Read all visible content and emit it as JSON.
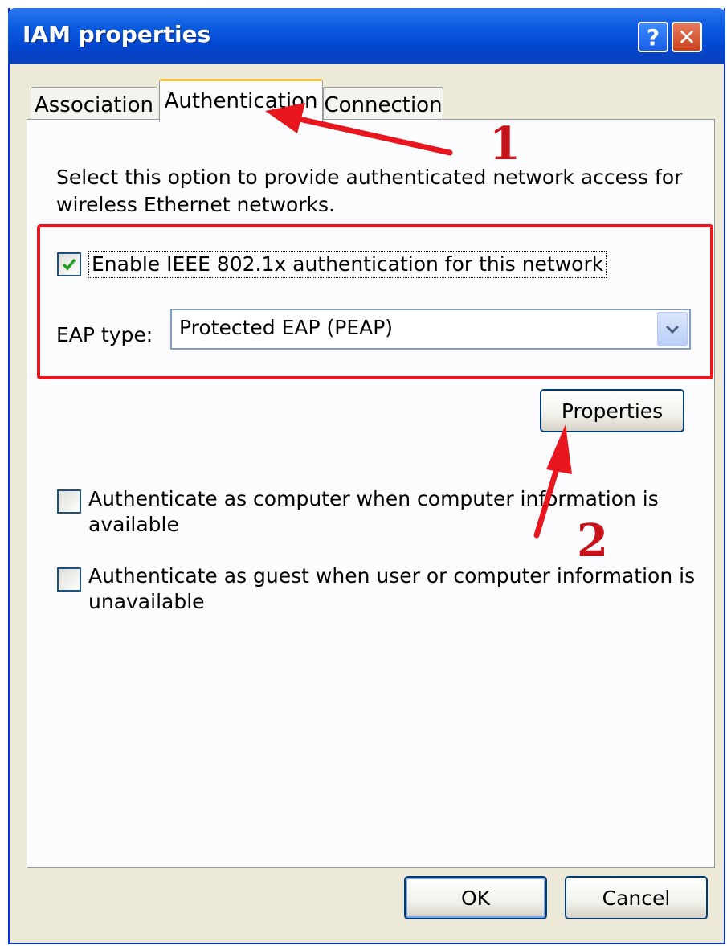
{
  "window": {
    "title": "IAM properties",
    "help_glyph": "?",
    "close_glyph": "✕"
  },
  "tabs": [
    {
      "label": "Association",
      "selected": false
    },
    {
      "label": "Authentication",
      "selected": true
    },
    {
      "label": "Connection",
      "selected": false
    }
  ],
  "authentication": {
    "description": "Select this option to provide authenticated network access for wireless Ethernet networks.",
    "enable_8021x": {
      "label": "Enable IEEE 802.1x authentication for this network",
      "checked": true
    },
    "eap_type": {
      "label": "EAP type:",
      "value": "Protected EAP (PEAP)"
    },
    "properties_button": "Properties",
    "auth_as_computer": {
      "label": "Authenticate as computer when computer information is available",
      "checked": false
    },
    "auth_as_guest": {
      "label": "Authenticate as guest when user or computer information is unavailable",
      "checked": false
    }
  },
  "footer": {
    "ok_label": "OK",
    "cancel_label": "Cancel"
  },
  "annotations": {
    "marker_1": "1",
    "marker_2": "2",
    "color": "#e8171f"
  },
  "colors": {
    "titlebar": "#0a5be0",
    "dialog_bg": "#ece9d8",
    "panel_bg": "#fcfcfe",
    "check_mark": "#21a121"
  }
}
